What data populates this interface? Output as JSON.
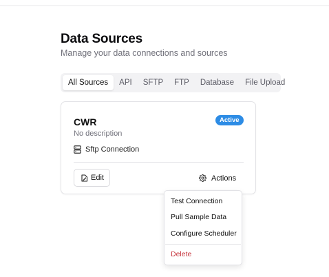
{
  "page": {
    "title": "Data Sources",
    "subtitle": "Manage your data connections and sources"
  },
  "tabs": [
    {
      "label": "All Sources",
      "active": true
    },
    {
      "label": "API",
      "active": false
    },
    {
      "label": "SFTP",
      "active": false
    },
    {
      "label": "FTP",
      "active": false
    },
    {
      "label": "Database",
      "active": false
    },
    {
      "label": "File Upload",
      "active": false
    }
  ],
  "card": {
    "name": "CWR",
    "description": "No description",
    "status": "Active",
    "status_color": "#2d8ce5",
    "connection_type": "Sftp Connection",
    "connection_icon": "server-icon",
    "edit_label": "Edit",
    "edit_icon": "edit-icon",
    "actions_label": "Actions",
    "actions_icon": "gear-icon"
  },
  "actions_menu": {
    "items": [
      {
        "label": "Test Connection"
      },
      {
        "label": "Pull Sample Data"
      },
      {
        "label": "Configure Scheduler"
      }
    ],
    "danger_item": {
      "label": "Delete",
      "color": "#c5323a"
    }
  }
}
